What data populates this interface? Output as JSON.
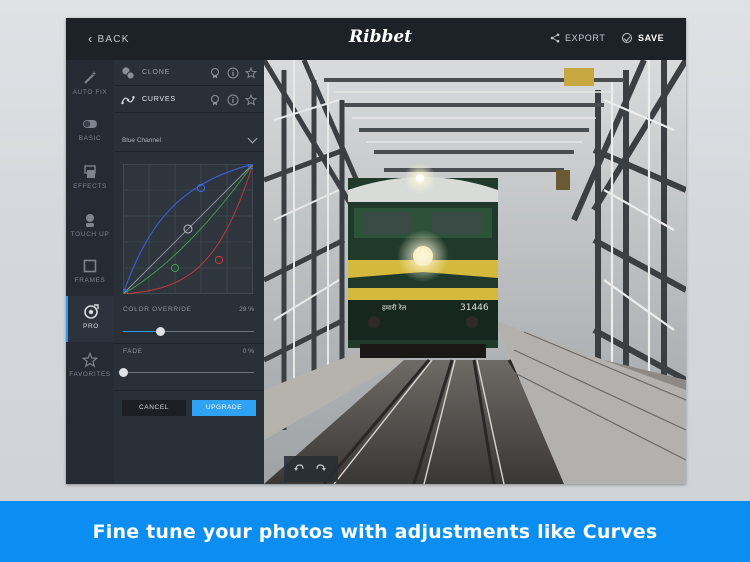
{
  "topbar": {
    "back_label": "BACK",
    "logo_text": "Ribbet",
    "export_label": "EXPORT",
    "save_label": "SAVE"
  },
  "rail": {
    "items": [
      {
        "label": "AUTO FIX",
        "icon": "magic-wand-icon"
      },
      {
        "label": "BASIC",
        "icon": "toggle-icon"
      },
      {
        "label": "EFFECTS",
        "icon": "effects-icon"
      },
      {
        "label": "TOUCH UP",
        "icon": "person-icon"
      },
      {
        "label": "FRAMES",
        "icon": "frame-icon"
      },
      {
        "label": "PRO",
        "icon": "pro-target-icon",
        "active": true
      },
      {
        "label": "FAVORITES",
        "icon": "star-icon"
      }
    ]
  },
  "panel": {
    "tools": [
      {
        "label": "CLONE",
        "icon": "clone-icon"
      },
      {
        "label": "CURVES",
        "icon": "curves-icon"
      }
    ],
    "channel": {
      "value": "Blue Channel"
    },
    "color_override": {
      "label": "COLOR OVERRIDE",
      "value": "29 %",
      "level": 0.29
    },
    "fade": {
      "label": "FADE",
      "value": "0 %",
      "level": 0
    },
    "cancel_label": "CANCEL",
    "upgrade_label": "UPGRADE"
  },
  "photo": {
    "locomotive_number": "31446",
    "locomotive_hindi": "हमारी रेल"
  },
  "caption": "Fine tune your photos with adjustments like Curves",
  "colors": {
    "accent": "#2b9cf2",
    "caption_bg": "#0b8df1",
    "panel_bg": "#2a3038",
    "topbar_bg": "#1d2128"
  }
}
